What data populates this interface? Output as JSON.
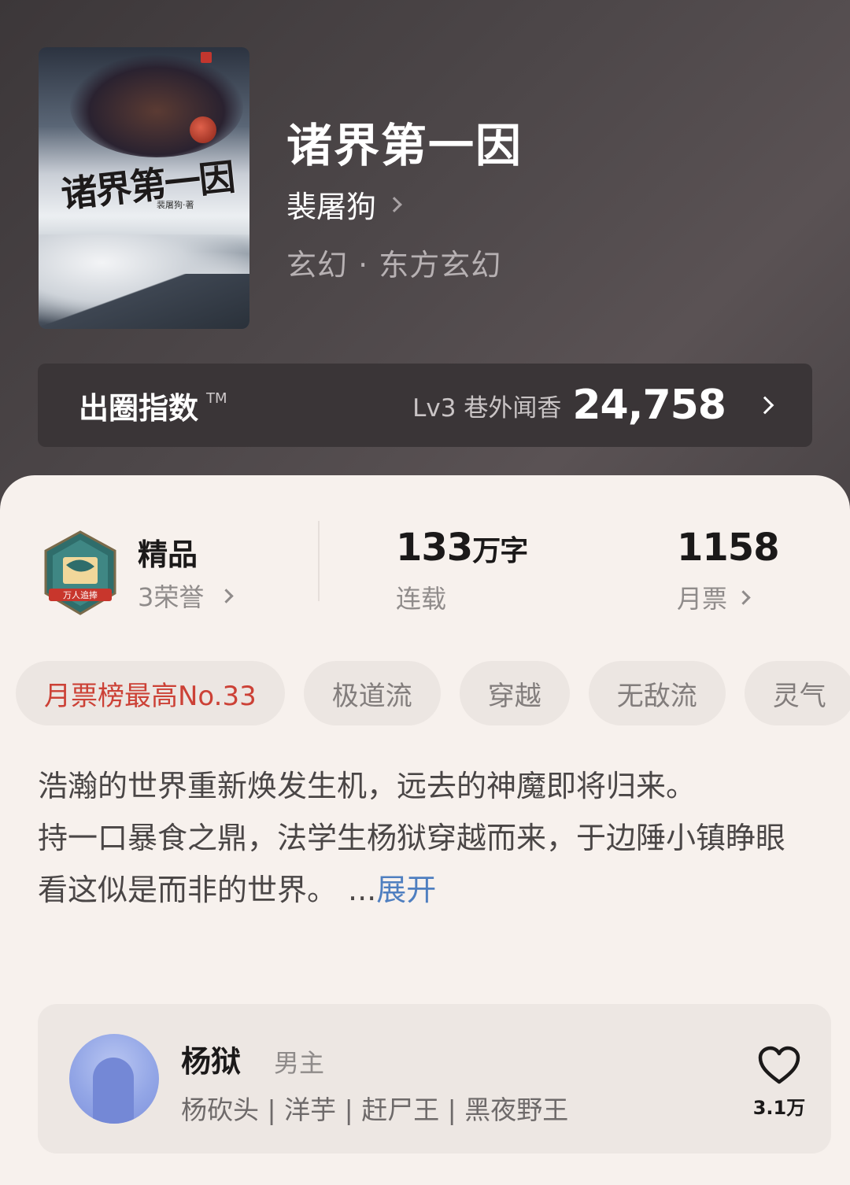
{
  "book": {
    "title": "诸界第一因",
    "author": "裴屠狗",
    "genre": "玄幻 · 东方玄幻",
    "cover": {
      "title_art": "诸界第一因",
      "author_art": "裴屠狗·著"
    }
  },
  "index_bar": {
    "label": "出圈指数",
    "tm": "TM",
    "level": "Lv3 巷外闻香",
    "value": "24,758"
  },
  "stats": {
    "quality": "精品",
    "honors": "3荣誉",
    "badge_text": "万人追捧",
    "words_number": "133",
    "words_unit": "万字",
    "status": "连载",
    "votes_number": "1158",
    "votes_label": "月票"
  },
  "tags": [
    "月票榜最高No.33",
    "极道流",
    "穿越",
    "无敌流",
    "灵气"
  ],
  "intro": {
    "para1": "浩瀚的世界重新焕发生机，远去的神魔即将归来。",
    "para2": "持一口暴食之鼎，法学生杨狱穿越而来，于边陲小镇睁眼看这似是而非的世界。",
    "ellipsis": "...",
    "expand": "展开"
  },
  "character": {
    "name": "杨狱",
    "role": "男主",
    "aliases": "杨砍头 | 洋芋 | 赶尸王 | 黑夜野王",
    "likes": "3.1万"
  },
  "colors": {
    "hero_bg": "#4a4446",
    "panel_bg": "#f7f1ed",
    "accent_red": "#cc4136",
    "link_blue": "#4f7fc0"
  }
}
